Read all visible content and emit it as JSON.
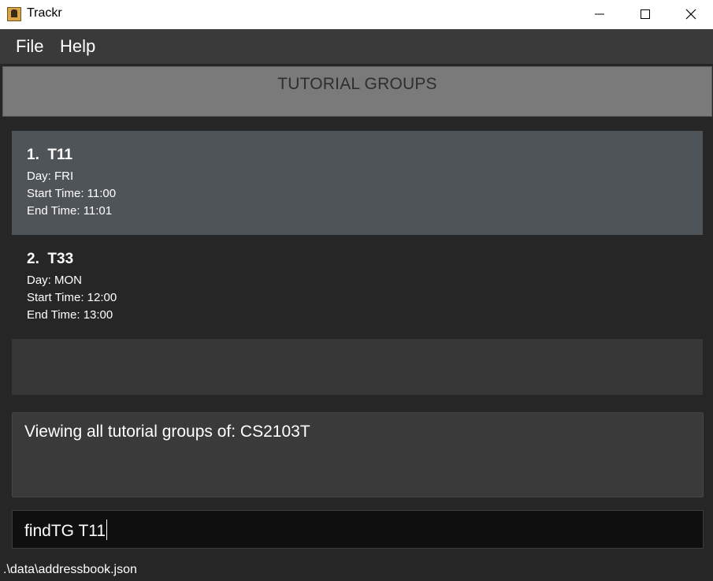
{
  "window": {
    "title": "Trackr",
    "icon": "trackr-app-icon",
    "controls": [
      "minimize-icon",
      "maximize-icon",
      "close-icon"
    ]
  },
  "menu": {
    "items": [
      {
        "label": "File"
      },
      {
        "label": "Help"
      }
    ]
  },
  "section_header": {
    "title": "TUTORIAL GROUPS"
  },
  "tutorial_groups": [
    {
      "title": "1.  T11",
      "day": "Day: FRI",
      "start": "Start Time: 11:00",
      "end": "End Time: 11:01",
      "selected": true
    },
    {
      "title": "2.  T33",
      "day": "Day: MON",
      "start": "Start Time: 12:00",
      "end": "End Time: 13:00",
      "selected": false
    }
  ],
  "result": {
    "message": "Viewing all tutorial groups of: CS2103T"
  },
  "command": {
    "value": "findTG T11"
  },
  "status": {
    "path": ".\\data\\addressbook.json"
  },
  "colors": {
    "background": "#262626",
    "menubar": "#3a3a3a",
    "header": "#7a7a7a",
    "selected_card": "#4f5458",
    "command_box": "#0f0f0f"
  }
}
